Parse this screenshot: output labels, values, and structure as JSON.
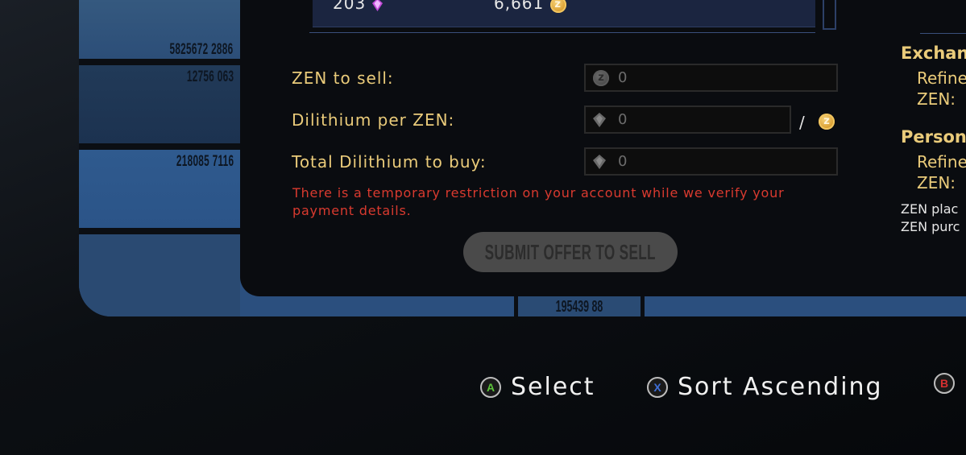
{
  "lcars": {
    "numbers": [
      "5825672 2886",
      "12756 063",
      "218085 7116"
    ],
    "bottom_number": "195439 88"
  },
  "list_row": {
    "quantity": "203",
    "price": "6,661",
    "quantity_icon": "dilithium-gem-icon",
    "price_icon": "zen-coin-icon"
  },
  "form": {
    "zen_to_sell_label": "ZEN to sell:",
    "zen_to_sell_value": "0",
    "dilithium_per_zen_label": "Dilithium per ZEN:",
    "dilithium_per_zen_value": "0",
    "per_separator": "/",
    "total_dilithium_label": "Total Dilithium to buy:",
    "total_dilithium_value": "0",
    "error_message": "There is a temporary restriction on your account while we verify your payment details.",
    "submit_label": "SUBMIT OFFER TO SELL"
  },
  "right_panel": {
    "exchange_heading": "Exchan",
    "exchange_refined": "Refine",
    "exchange_zen": "ZEN:",
    "personal_heading": "Person",
    "personal_refined": "Refine",
    "personal_zen": "ZEN:",
    "note_line1": "ZEN plac",
    "note_line2": "ZEN purc"
  },
  "hints": [
    {
      "key": "A",
      "label": "Select",
      "color": "#5cc43a"
    },
    {
      "key": "X",
      "label": "Sort Ascending",
      "color": "#3f6fd8"
    },
    {
      "key": "B",
      "label": "",
      "color": "#d83030"
    }
  ],
  "colors": {
    "accent_gold": "#eacb7a",
    "error_red": "#d93a2f",
    "lcars_blue": "#2b4f7e"
  }
}
